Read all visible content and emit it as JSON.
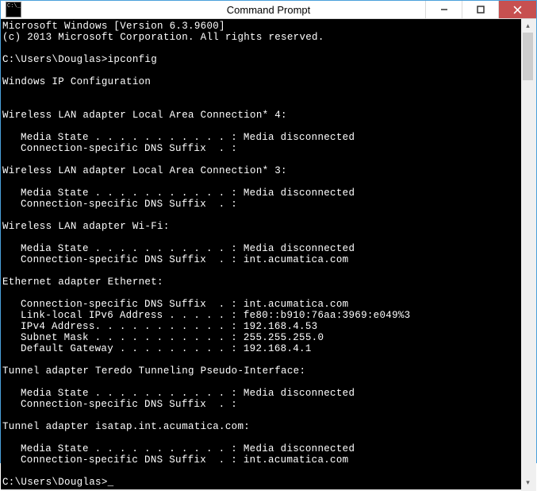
{
  "window": {
    "title": "Command Prompt"
  },
  "terminal": {
    "version_line": "Microsoft Windows [Version 6.3.9600]",
    "copyright_line": "(c) 2013 Microsoft Corporation. All rights reserved.",
    "prompt_path": "C:\\Users\\Douglas>",
    "command": "ipconfig",
    "config_header": "Windows IP Configuration",
    "adapters": [
      {
        "header": "Wireless LAN adapter Local Area Connection* 4:",
        "lines": [
          "Media State . . . . . . . . . . . : Media disconnected",
          "Connection-specific DNS Suffix  . :"
        ]
      },
      {
        "header": "Wireless LAN adapter Local Area Connection* 3:",
        "lines": [
          "Media State . . . . . . . . . . . : Media disconnected",
          "Connection-specific DNS Suffix  . :"
        ]
      },
      {
        "header": "Wireless LAN adapter Wi-Fi:",
        "lines": [
          "Media State . . . . . . . . . . . : Media disconnected",
          "Connection-specific DNS Suffix  . : int.acumatica.com"
        ]
      },
      {
        "header": "Ethernet adapter Ethernet:",
        "lines": [
          "Connection-specific DNS Suffix  . : int.acumatica.com",
          "Link-local IPv6 Address . . . . . : fe80::b910:76aa:3969:e049%3",
          "IPv4 Address. . . . . . . . . . . : 192.168.4.53",
          "Subnet Mask . . . . . . . . . . . : 255.255.255.0",
          "Default Gateway . . . . . . . . . : 192.168.4.1"
        ]
      },
      {
        "header": "Tunnel adapter Teredo Tunneling Pseudo-Interface:",
        "lines": [
          "Media State . . . . . . . . . . . : Media disconnected",
          "Connection-specific DNS Suffix  . :"
        ]
      },
      {
        "header": "Tunnel adapter isatap.int.acumatica.com:",
        "lines": [
          "Media State . . . . . . . . . . . : Media disconnected",
          "Connection-specific DNS Suffix  . : int.acumatica.com"
        ]
      }
    ]
  }
}
